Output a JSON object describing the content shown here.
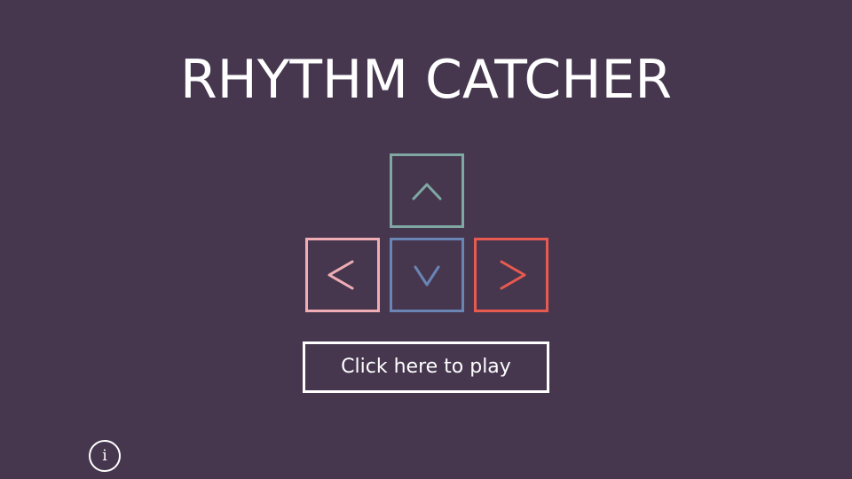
{
  "title": "RHYTHM CATCHER",
  "keys": [
    {
      "direction": "up",
      "icon": "chevron-up-icon",
      "color": "#7fa8a3"
    },
    {
      "direction": "left",
      "icon": "chevron-left-icon",
      "color": "#f0aeb4"
    },
    {
      "direction": "down",
      "icon": "chevron-down-icon",
      "color": "#6a84b4"
    },
    {
      "direction": "right",
      "icon": "chevron-right-icon",
      "color": "#e85a4f"
    }
  ],
  "play_button": {
    "label": "Click here to play"
  },
  "info_button": {
    "label": "i",
    "icon": "info-icon"
  },
  "colors": {
    "background": "#46374f",
    "text": "#ffffff"
  }
}
